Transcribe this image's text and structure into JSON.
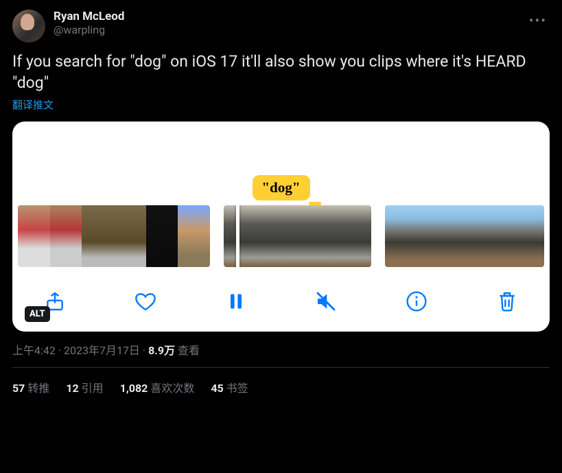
{
  "user": {
    "display_name": "Ryan McLeod",
    "handle": "@warpling"
  },
  "tweet": {
    "text": "If you search for \"dog\" on iOS 17 it'll also show you clips where it's HEARD \"dog\"",
    "translate_label": "翻译推文"
  },
  "media": {
    "highlight_label": "\"dog\"",
    "alt_badge": "ALT"
  },
  "meta": {
    "time": "上午4:42",
    "dot": " · ",
    "date": "2023年7月17日",
    "views_count": "8.9万",
    "views_label": " 查看"
  },
  "stats": {
    "retweets_count": "57",
    "retweets_label": " 转推",
    "quotes_count": "12",
    "quotes_label": " 引用",
    "likes_count": "1,082",
    "likes_label": " 喜欢次数",
    "bookmarks_count": "45",
    "bookmarks_label": " 书签"
  }
}
